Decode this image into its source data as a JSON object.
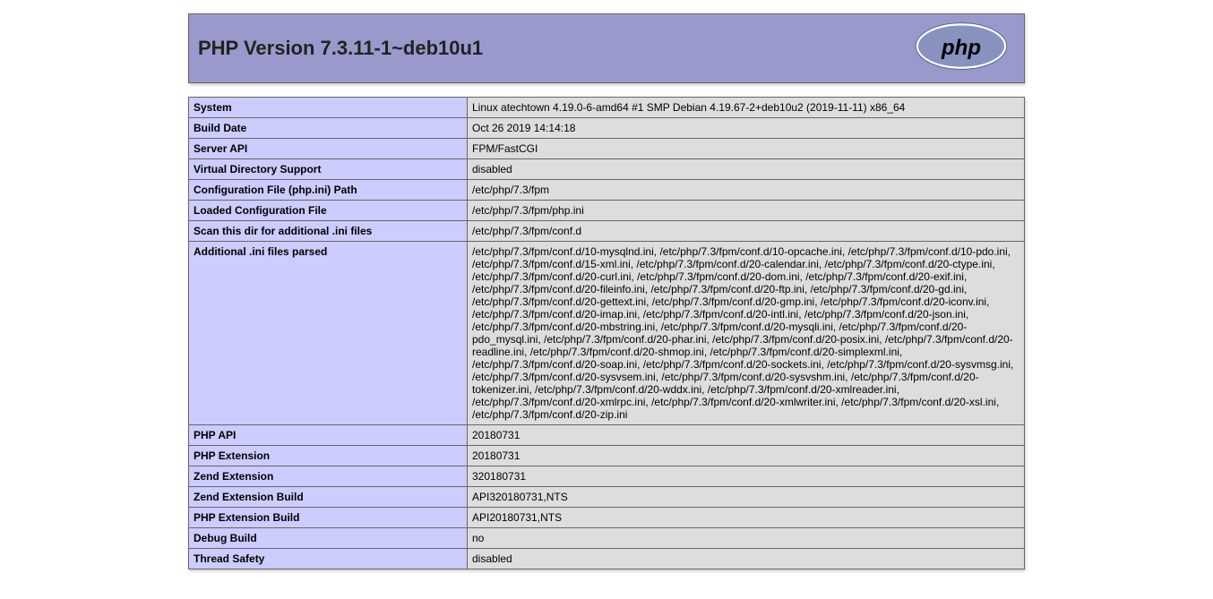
{
  "header": {
    "title": "PHP Version 7.3.11-1~deb10u1"
  },
  "info": [
    {
      "key": "System",
      "value": "Linux atechtown 4.19.0-6-amd64 #1 SMP Debian 4.19.67-2+deb10u2 (2019-11-11) x86_64"
    },
    {
      "key": "Build Date",
      "value": "Oct 26 2019 14:14:18"
    },
    {
      "key": "Server API",
      "value": "FPM/FastCGI"
    },
    {
      "key": "Virtual Directory Support",
      "value": "disabled"
    },
    {
      "key": "Configuration File (php.ini) Path",
      "value": "/etc/php/7.3/fpm"
    },
    {
      "key": "Loaded Configuration File",
      "value": "/etc/php/7.3/fpm/php.ini"
    },
    {
      "key": "Scan this dir for additional .ini files",
      "value": "/etc/php/7.3/fpm/conf.d"
    },
    {
      "key": "Additional .ini files parsed",
      "value": "/etc/php/7.3/fpm/conf.d/10-mysqlnd.ini, /etc/php/7.3/fpm/conf.d/10-opcache.ini, /etc/php/7.3/fpm/conf.d/10-pdo.ini, /etc/php/7.3/fpm/conf.d/15-xml.ini, /etc/php/7.3/fpm/conf.d/20-calendar.ini, /etc/php/7.3/fpm/conf.d/20-ctype.ini, /etc/php/7.3/fpm/conf.d/20-curl.ini, /etc/php/7.3/fpm/conf.d/20-dom.ini, /etc/php/7.3/fpm/conf.d/20-exif.ini, /etc/php/7.3/fpm/conf.d/20-fileinfo.ini, /etc/php/7.3/fpm/conf.d/20-ftp.ini, /etc/php/7.3/fpm/conf.d/20-gd.ini, /etc/php/7.3/fpm/conf.d/20-gettext.ini, /etc/php/7.3/fpm/conf.d/20-gmp.ini, /etc/php/7.3/fpm/conf.d/20-iconv.ini, /etc/php/7.3/fpm/conf.d/20-imap.ini, /etc/php/7.3/fpm/conf.d/20-intl.ini, /etc/php/7.3/fpm/conf.d/20-json.ini, /etc/php/7.3/fpm/conf.d/20-mbstring.ini, /etc/php/7.3/fpm/conf.d/20-mysqli.ini, /etc/php/7.3/fpm/conf.d/20-pdo_mysql.ini, /etc/php/7.3/fpm/conf.d/20-phar.ini, /etc/php/7.3/fpm/conf.d/20-posix.ini, /etc/php/7.3/fpm/conf.d/20-readline.ini, /etc/php/7.3/fpm/conf.d/20-shmop.ini, /etc/php/7.3/fpm/conf.d/20-simplexml.ini, /etc/php/7.3/fpm/conf.d/20-soap.ini, /etc/php/7.3/fpm/conf.d/20-sockets.ini, /etc/php/7.3/fpm/conf.d/20-sysvmsg.ini, /etc/php/7.3/fpm/conf.d/20-sysvsem.ini, /etc/php/7.3/fpm/conf.d/20-sysvshm.ini, /etc/php/7.3/fpm/conf.d/20-tokenizer.ini, /etc/php/7.3/fpm/conf.d/20-wddx.ini, /etc/php/7.3/fpm/conf.d/20-xmlreader.ini, /etc/php/7.3/fpm/conf.d/20-xmlrpc.ini, /etc/php/7.3/fpm/conf.d/20-xmlwriter.ini, /etc/php/7.3/fpm/conf.d/20-xsl.ini, /etc/php/7.3/fpm/conf.d/20-zip.ini"
    },
    {
      "key": "PHP API",
      "value": "20180731"
    },
    {
      "key": "PHP Extension",
      "value": "20180731"
    },
    {
      "key": "Zend Extension",
      "value": "320180731"
    },
    {
      "key": "Zend Extension Build",
      "value": "API320180731,NTS"
    },
    {
      "key": "PHP Extension Build",
      "value": "API20180731,NTS"
    },
    {
      "key": "Debug Build",
      "value": "no"
    },
    {
      "key": "Thread Safety",
      "value": "disabled"
    }
  ]
}
